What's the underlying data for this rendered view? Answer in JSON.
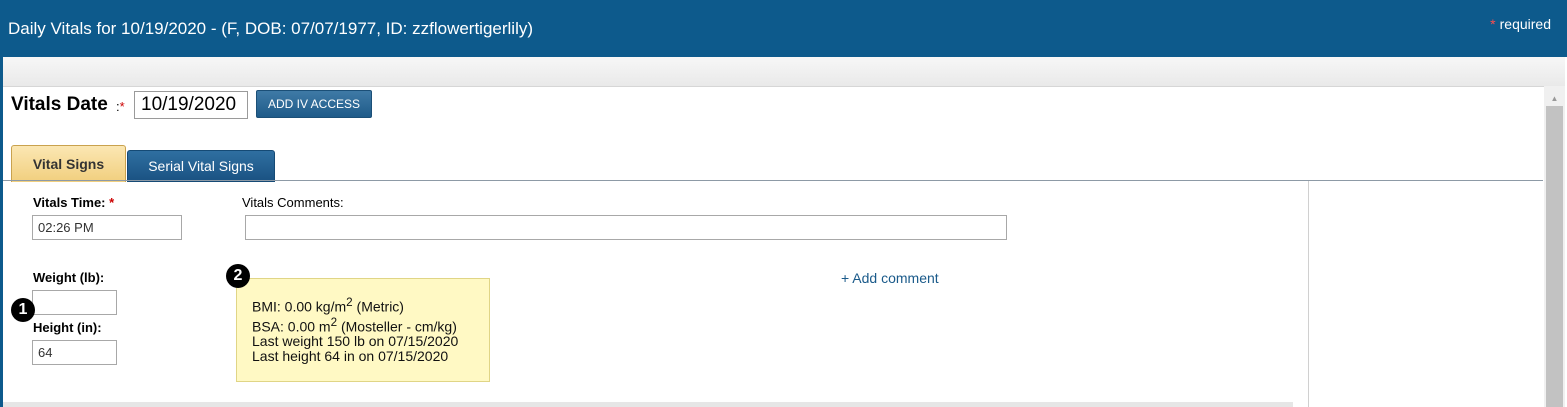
{
  "header": {
    "title": "Daily Vitals for 10/19/2020 - (F, DOB: 07/07/1977, ID: zzflowertigerlily)",
    "required_star": "*",
    "required_text": "required"
  },
  "form": {
    "vitals_date_label": "Vitals Date",
    "vitals_date_colon": ":",
    "required_star": "*",
    "vitals_date_value": "10/19/2020",
    "add_iv_button": "ADD IV ACCESS"
  },
  "tabs": {
    "active": "Vital Signs",
    "inactive": "Serial Vital Signs"
  },
  "fields": {
    "vitals_time_label": "Vitals Time:",
    "vitals_time_value": "02:26 PM",
    "vitals_comments_label": "Vitals Comments:",
    "vitals_comments_value": "",
    "weight_label": "Weight (lb):",
    "weight_value": "",
    "height_label": "Height (in):",
    "height_value": "64",
    "add_comment": "+ Add comment"
  },
  "info": {
    "bmi_prefix": "BMI: 0.00 kg/m",
    "bmi_exp": "2",
    "bmi_suffix": " (Metric)",
    "bsa_prefix": "BSA: 0.00 m",
    "bsa_exp": "2",
    "bsa_suffix": " (Mosteller - cm/kg)",
    "last_weight": "Last weight 150 lb on 07/15/2020",
    "last_height": "Last height 64 in on 07/15/2020"
  },
  "badges": {
    "one": "1",
    "two": "2"
  },
  "colors": {
    "header": "#0d5a8c",
    "active_tab": "#f1cf7e",
    "inactive_tab": "#1a5282",
    "info_box": "#fff9c4"
  }
}
